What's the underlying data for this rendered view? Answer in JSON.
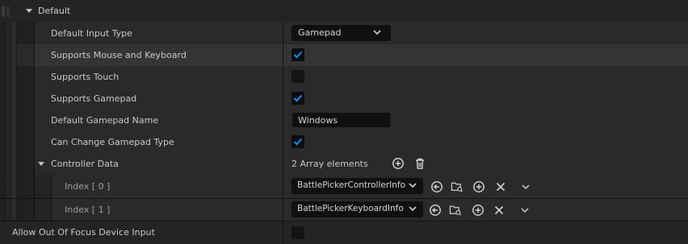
{
  "section": {
    "title": "Default"
  },
  "props": {
    "default_input_type": {
      "label": "Default Input Type",
      "value": "Gamepad"
    },
    "supports_mouse_keyboard": {
      "label": "Supports Mouse and Keyboard",
      "checked": true
    },
    "supports_touch": {
      "label": "Supports Touch",
      "checked": false
    },
    "supports_gamepad": {
      "label": "Supports Gamepad",
      "checked": true
    },
    "default_gamepad_name": {
      "label": "Default Gamepad Name",
      "value": "Windows"
    },
    "can_change_gamepad_type": {
      "label": "Can Change Gamepad Type",
      "checked": true
    },
    "controller_data": {
      "label": "Controller Data",
      "count_text": "2 Array elements",
      "elements": [
        {
          "index_label": "Index [ 0 ]",
          "value": "BattlePickerControllerInfo"
        },
        {
          "index_label": "Index [ 1 ]",
          "value": "BattlePickerKeyboardInfo"
        }
      ]
    },
    "allow_out_of_focus": {
      "label": "Allow Out Of Focus Device Input",
      "checked": false
    }
  },
  "colors": {
    "check_accent": "#1a8cff",
    "panel": "#2a2a2a",
    "highlight": "#343434"
  }
}
